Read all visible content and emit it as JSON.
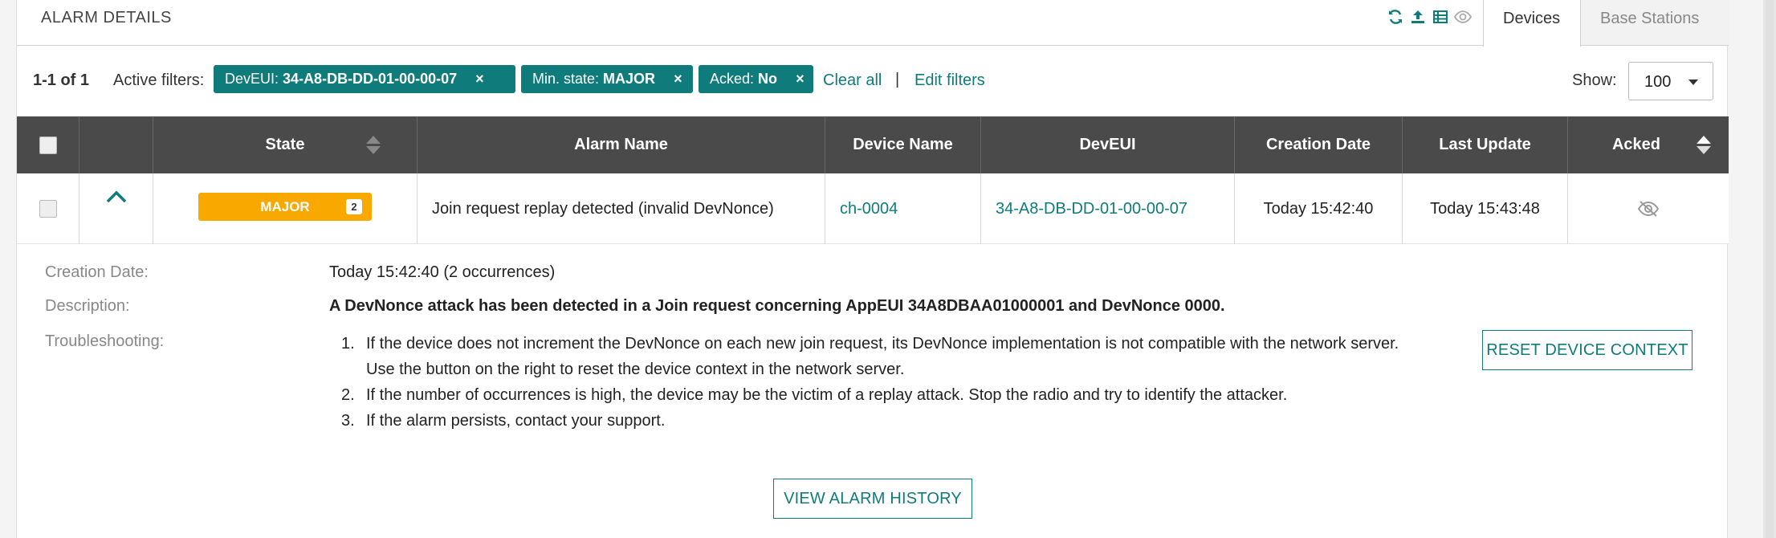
{
  "header": {
    "title": "ALARM DETAILS",
    "tabs": [
      {
        "label": "Devices",
        "active": true
      },
      {
        "label": "Base Stations",
        "active": false
      }
    ],
    "icons": [
      "refresh-icon",
      "upload-icon",
      "table-icon",
      "eye-icon"
    ]
  },
  "filters": {
    "count": "1-1 of 1",
    "active_label": "Active filters:",
    "chips": [
      {
        "key": "DevEUI:",
        "value": "34-A8-DB-DD-01-00-00-07",
        "remove": "×"
      },
      {
        "key": "Min. state:",
        "value": "MAJOR",
        "remove": "×"
      },
      {
        "key": "Acked:",
        "value": "No",
        "remove": "×"
      }
    ],
    "clear_all": "Clear all",
    "separator": "|",
    "edit_filters": "Edit filters",
    "show_label": "Show:",
    "show_value": "100"
  },
  "table": {
    "columns": [
      "State",
      "Alarm Name",
      "Device Name",
      "DevEUI",
      "Creation Date",
      "Last Update",
      "Acked"
    ],
    "row": {
      "state": "MAJOR",
      "occurrences": "2",
      "alarm_name": "Join request replay detected (invalid DevNonce)",
      "device_name": "ch-0004",
      "deveui": "34-A8-DB-DD-01-00-00-07",
      "creation_date": "Today 15:42:40",
      "last_update": "Today 15:43:48"
    }
  },
  "details": {
    "creation_label": "Creation Date:",
    "creation_value": "Today 15:42:40 (2 occurrences)",
    "description_label": "Description:",
    "description_value": "A DevNonce attack has been detected in a Join request concerning AppEUI 34A8DBAA01000001 and DevNonce 0000.",
    "troubleshooting_label": "Troubleshooting:",
    "steps": [
      {
        "n": "1.",
        "text": "If the device does not increment the DevNonce on each new join request, its DevNonce implementation is not compatible with the network server. Use the button on the right to reset the device context in the network server."
      },
      {
        "n": "2.",
        "text": "If the number of occurrences is high, the device may be the victim of a replay attack. Stop the radio and try to identify the attacker."
      },
      {
        "n": "3.",
        "text": "If the alarm persists, contact your support."
      }
    ],
    "reset_button": "RESET DEVICE CONTEXT",
    "history_button": "VIEW ALARM HISTORY"
  },
  "colors": {
    "accent": "#0f7b7b",
    "major": "#f9a800",
    "table_header": "#4a4a4a"
  }
}
